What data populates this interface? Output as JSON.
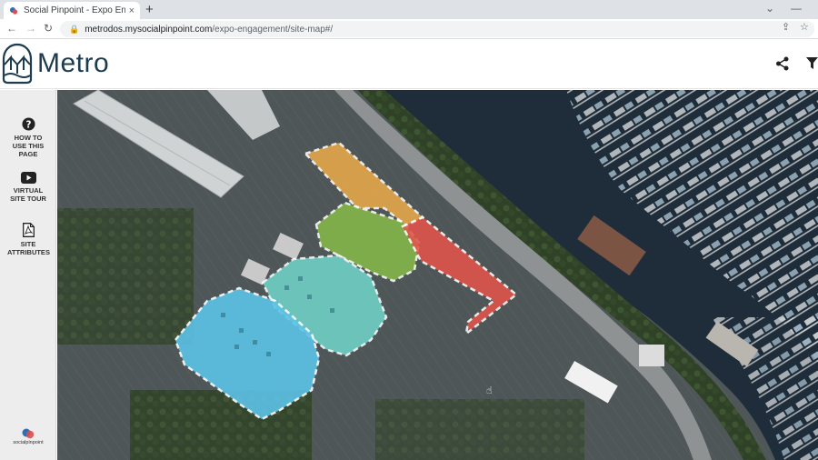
{
  "browser": {
    "tab_title": "Social Pinpoint - Expo Engageme",
    "tab_close": "×",
    "new_tab": "+",
    "url_host": "metrodos.mysocialpinpoint.com",
    "url_path": "/expo-engagement/site-map#/"
  },
  "header": {
    "brand": "Metro"
  },
  "sidebar": {
    "items": [
      {
        "label": "HOW TO USE THIS PAGE",
        "icon": "help-circle-icon"
      },
      {
        "label": "VIRTUAL SITE TOUR",
        "icon": "video-play-icon"
      },
      {
        "label": "SITE ATTRIBUTES",
        "icon": "pdf-document-icon"
      }
    ],
    "footer_logo_text": "socialpinpoint"
  },
  "map": {
    "zones": [
      {
        "name": "orange",
        "color": "#e8a94a"
      },
      {
        "name": "green",
        "color": "#86b84a"
      },
      {
        "name": "red",
        "color": "#e2544a"
      },
      {
        "name": "teal",
        "color": "#6fd3c8"
      },
      {
        "name": "blue",
        "color": "#5cc3e6"
      }
    ]
  }
}
